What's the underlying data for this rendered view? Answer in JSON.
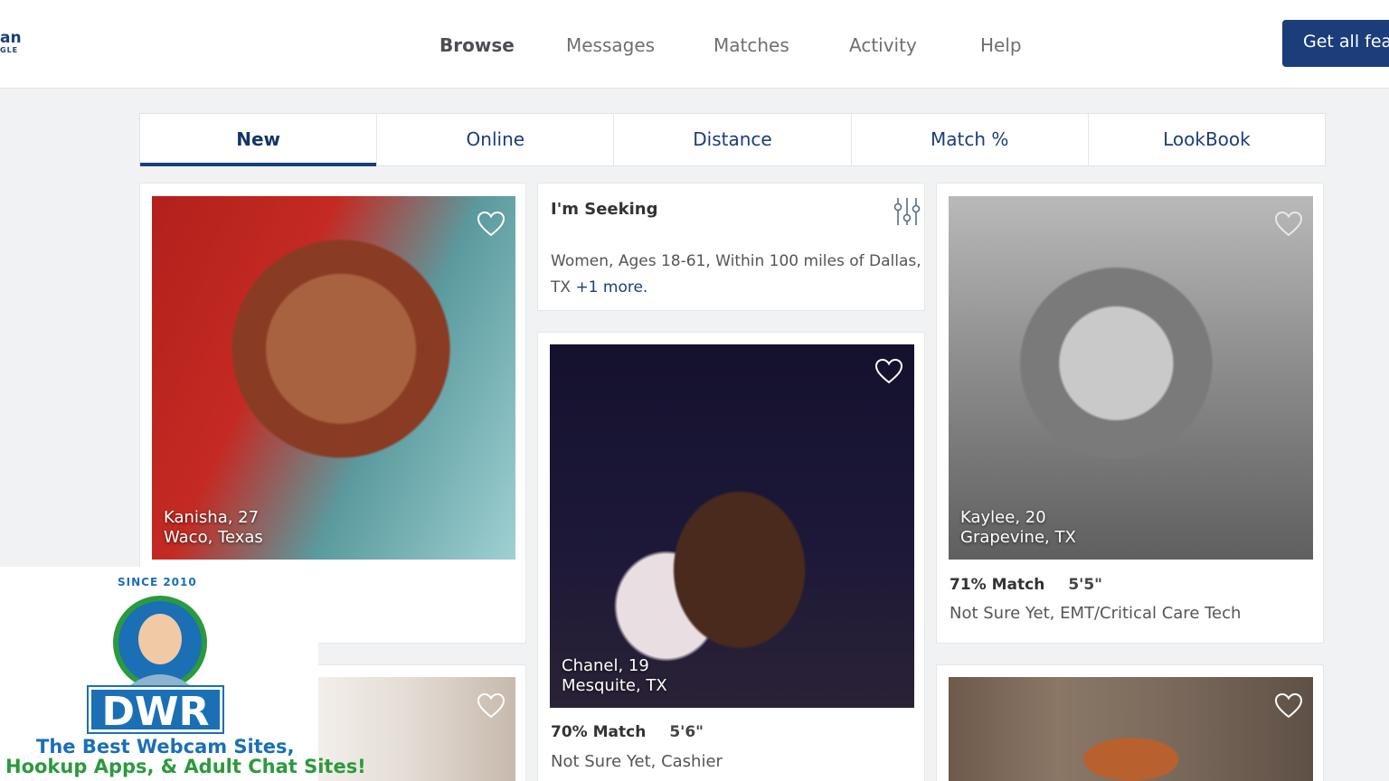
{
  "header": {
    "logo_line1": "an",
    "logo_line2": "GLE",
    "nav": [
      "Browse",
      "Messages",
      "Matches",
      "Activity",
      "Help"
    ],
    "active_nav": "Browse",
    "cta_label": "Get all fea"
  },
  "tabs": [
    "New",
    "Online",
    "Distance",
    "Match %",
    "LookBook"
  ],
  "active_tab": "New",
  "seeking": {
    "title": "I'm Seeking",
    "text": "Women, Ages 18-61, Within 100 miles of Dallas, TX",
    "more": "+1 more."
  },
  "profiles": [
    {
      "name_age": "Kanisha, 27",
      "location": "Waco, Texas"
    },
    {
      "name_age": "Chanel, 19",
      "location": "Mesquite, TX",
      "match": "70% Match",
      "height": "5'6\"",
      "details": "Not Sure Yet, Cashier"
    },
    {
      "name_age": "Kaylee, 20",
      "location": "Grapevine, TX",
      "match": "71% Match",
      "height": "5'5\"",
      "details": "Not Sure Yet, EMT/Critical Care Tech"
    }
  ],
  "watermark": {
    "since": "SINCE 2010",
    "brand": "DWR",
    "line1": "The Best Webcam Sites,",
    "line2": "Hookup Apps, & Adult Chat Sites!"
  },
  "colors": {
    "brand": "#1b3d7a",
    "accent_blue": "#1b6fb5",
    "accent_green": "#2b9a3e"
  }
}
